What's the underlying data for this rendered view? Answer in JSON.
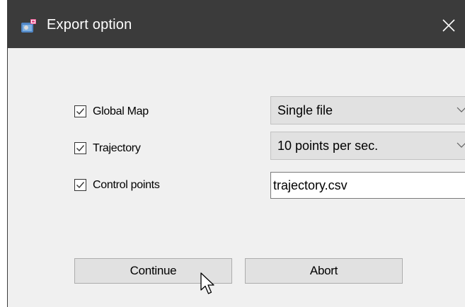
{
  "window": {
    "title": "Export option"
  },
  "options": [
    {
      "label": "Global Map",
      "checked": true,
      "control": "dropdown",
      "value": "Single file"
    },
    {
      "label": "Trajectory",
      "checked": true,
      "control": "dropdown",
      "value": "10 points per sec."
    },
    {
      "label": "Control points",
      "checked": true,
      "control": "textbox",
      "value": "trajectory.csv"
    }
  ],
  "buttons": {
    "continue_label": "Continue",
    "abort_label": "Abort"
  },
  "icons": {
    "app": "app-icon",
    "close": "close-icon",
    "check": "checkmark-icon",
    "dropdown": "chevron-down-icon",
    "cursor": "mouse-pointer-icon"
  },
  "colors": {
    "titlebar": "#3b3b3b",
    "dialog_background": "#f0f0f0",
    "button_face": "#e1e1e1"
  }
}
